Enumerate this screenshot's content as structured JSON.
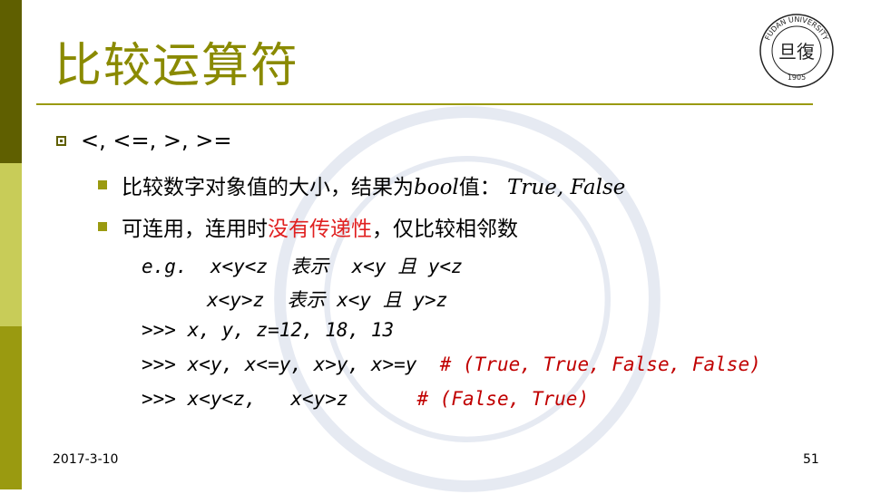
{
  "slide": {
    "title": "比较运算符",
    "logo": {
      "university": "FUDAN UNIVERSITY",
      "year": "1905",
      "emblem_text": "旦復"
    },
    "bullet1": "<, <=, >, >=",
    "bullet2": {
      "before": "比较数字对象值的大小，结果为",
      "bool": "bool",
      "after": "值：",
      "values": "True, False"
    },
    "bullet3": {
      "before": "可连用，连用时",
      "highlight": "没有传递性",
      "after": "，仅比较相邻数"
    },
    "code": {
      "line1": "e.g.  x<y<z  表示  x<y 且 y<z",
      "line2": "x<y>z  表示 x<y 且 y>z",
      "line3": ">>> x, y, z=12, 18, 13",
      "line4_code": ">>> x<y, x<=y, x>y, x>=y",
      "line4_comment": "# (True, True, False, False)",
      "line5_code": ">>> x<y<z,   x<y>z",
      "line5_comment": "# (False, True)"
    },
    "footer": {
      "date": "2017-3-10",
      "page": "51"
    },
    "colors": {
      "title": "#8a8a00",
      "bar_dark": "#5f5f00",
      "bar_light": "#c8cc58",
      "highlight": "#e02020"
    }
  }
}
